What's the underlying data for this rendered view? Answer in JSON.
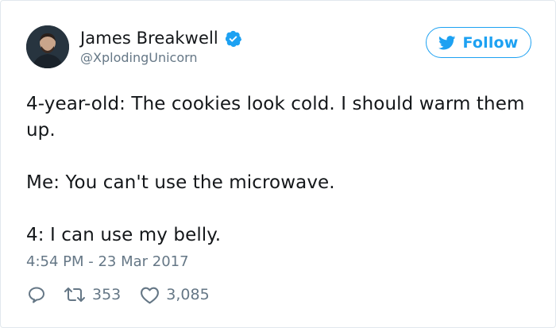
{
  "colors": {
    "accent": "#1da1f2",
    "secondary_text": "#657786",
    "primary_text": "#14171a",
    "border": "#e1e8ed"
  },
  "user": {
    "display_name": "James Breakwell",
    "handle": "@XplodingUnicorn",
    "verified": true,
    "avatar_icon": "avatar-photo"
  },
  "follow_button": {
    "label": "Follow",
    "icon": "twitter-bird-icon"
  },
  "tweet": {
    "lines": [
      "4-year-old: The cookies look cold. I should warm them up.",
      "Me: You can't use the microwave.",
      "4: I can use my belly."
    ],
    "timestamp": "4:54 PM - 23 Mar 2017"
  },
  "actions": {
    "reply_icon": "reply-icon",
    "retweet_icon": "retweet-icon",
    "retweet_count": "353",
    "like_icon": "heart-icon",
    "like_count": "3,085"
  }
}
